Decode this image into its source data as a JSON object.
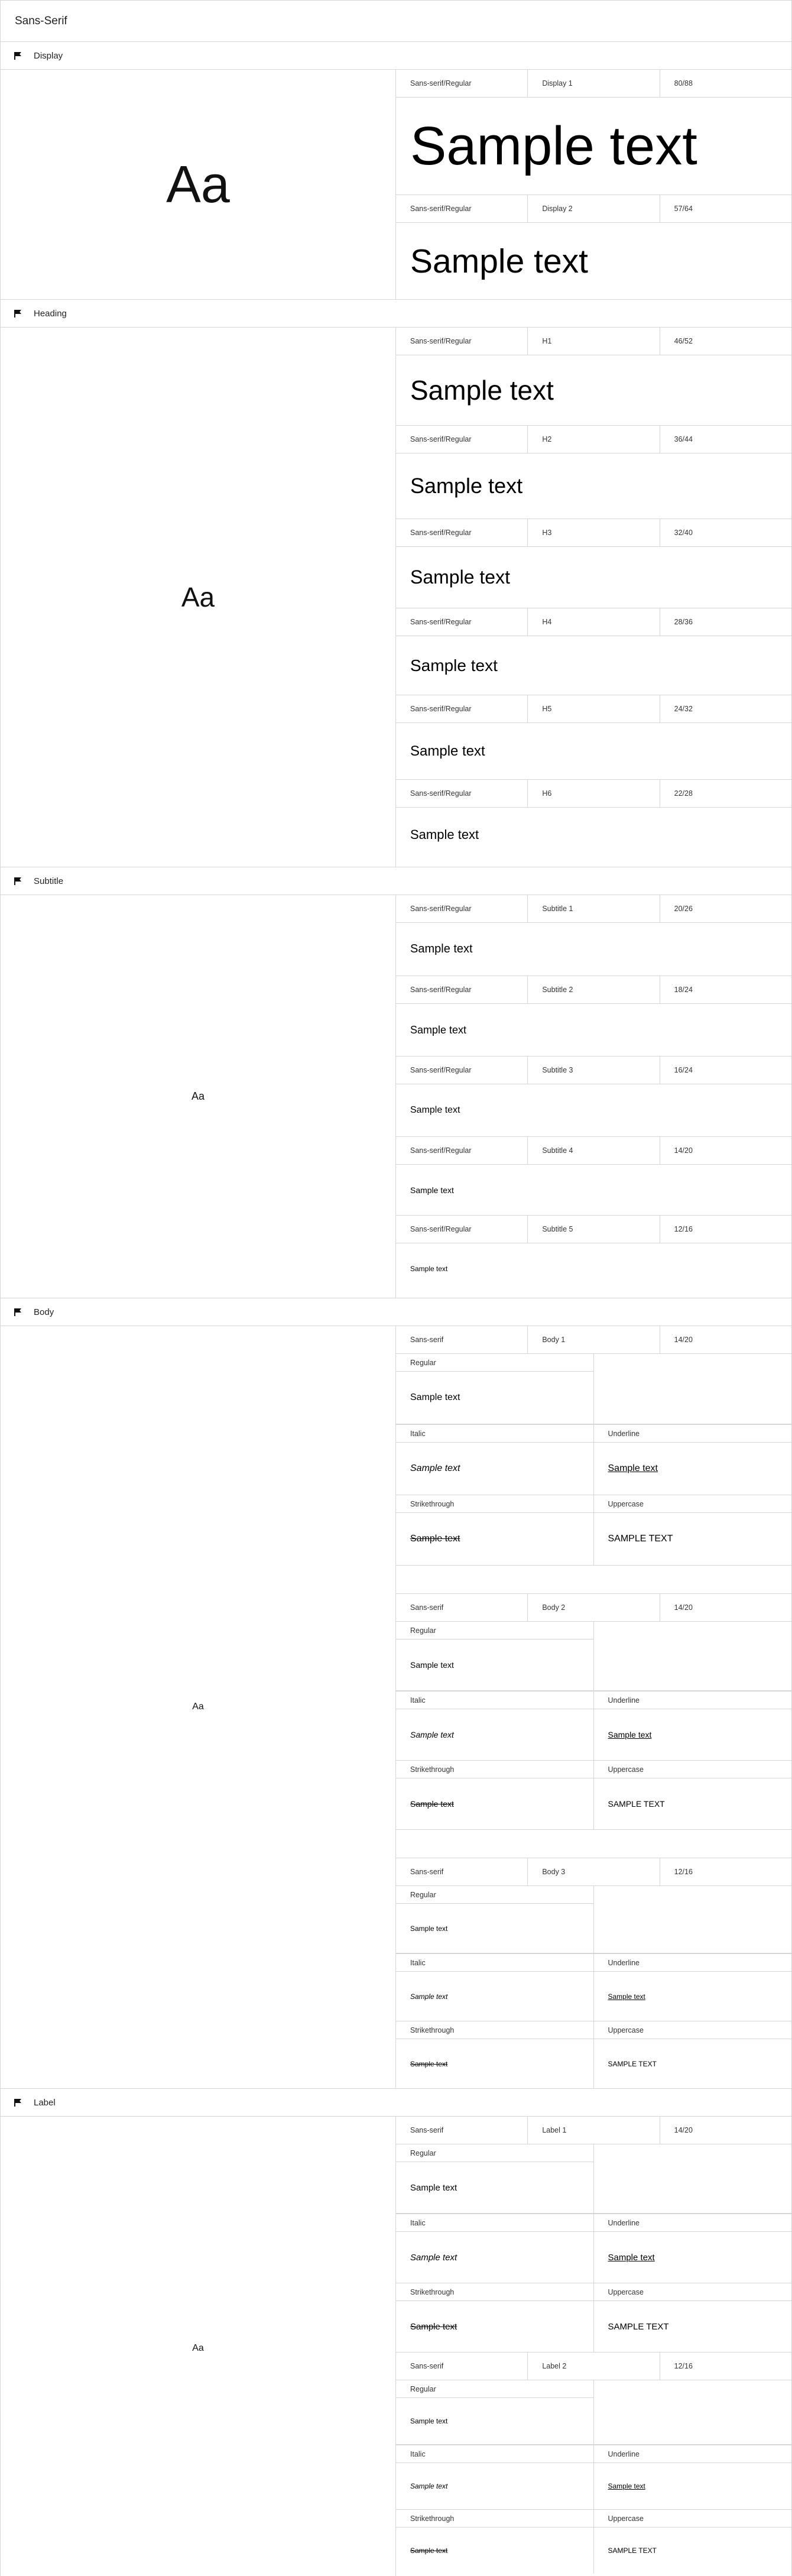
{
  "page_title": "Sans-Serif",
  "sample_text": "Sample text",
  "specimen": "Aa",
  "sections": [
    {
      "name": "Display",
      "rows": [
        {
          "font": "Sans-serif/Regular",
          "style": "Display 1",
          "metrics": "80/88"
        },
        {
          "font": "Sans-serif/Regular",
          "style": "Display 2",
          "metrics": "57/64"
        }
      ]
    },
    {
      "name": "Heading",
      "rows": [
        {
          "font": "Sans-serif/Regular",
          "style": "H1",
          "metrics": "46/52"
        },
        {
          "font": "Sans-serif/Regular",
          "style": "H2",
          "metrics": "36/44"
        },
        {
          "font": "Sans-serif/Regular",
          "style": "H3",
          "metrics": "32/40"
        },
        {
          "font": "Sans-serif/Regular",
          "style": "H4",
          "metrics": "28/36"
        },
        {
          "font": "Sans-serif/Regular",
          "style": "H5",
          "metrics": "24/32"
        },
        {
          "font": "Sans-serif/Regular",
          "style": "H6",
          "metrics": "22/28"
        }
      ]
    },
    {
      "name": "Subtitle",
      "rows": [
        {
          "font": "Sans-serif/Regular",
          "style": "Subtitle 1",
          "metrics": "20/26"
        },
        {
          "font": "Sans-serif/Regular",
          "style": "Subtitle 2",
          "metrics": "18/24"
        },
        {
          "font": "Sans-serif/Regular",
          "style": "Subtitle 3",
          "metrics": "16/24"
        },
        {
          "font": "Sans-serif/Regular",
          "style": "Subtitle 4",
          "metrics": "14/20"
        },
        {
          "font": "Sans-serif/Regular",
          "style": "Subtitle 5",
          "metrics": "12/16"
        }
      ]
    },
    {
      "name": "Body",
      "groups": [
        {
          "font": "Sans-serif",
          "style": "Body 1",
          "metrics": "14/20"
        },
        {
          "font": "Sans-serif",
          "style": "Body 2",
          "metrics": "14/20"
        },
        {
          "font": "Sans-serif",
          "style": "Body 3",
          "metrics": "12/16"
        }
      ]
    },
    {
      "name": "Label",
      "groups": [
        {
          "font": "Sans-serif",
          "style": "Label 1",
          "metrics": "14/20"
        },
        {
          "font": "Sans-serif",
          "style": "Label 2",
          "metrics": "12/16"
        }
      ]
    }
  ],
  "variants": {
    "regular": "Regular",
    "italic": "Italic",
    "underline": "Underline",
    "strikethrough": "Strikethrough",
    "uppercase": "Uppercase"
  },
  "icons": {
    "section": "flag-icon"
  }
}
